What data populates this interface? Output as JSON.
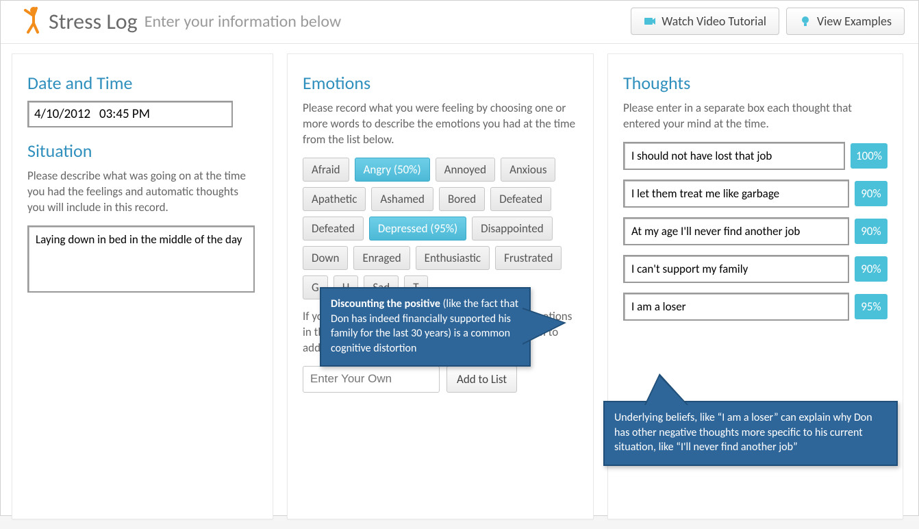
{
  "header": {
    "title": "Stress Log",
    "subtitle": "Enter your information below",
    "watch_button": "Watch Video Tutorial",
    "examples_button": "View Examples"
  },
  "left": {
    "date_heading": "Date and Time",
    "date_value": "4/10/2012",
    "time_value": "03:45 PM",
    "situation_heading": "Situation",
    "situation_desc": "Please describe what was going on at the time you had the feelings and automatic thoughts you will include in this record.",
    "situation_value": "Laying down in bed in the middle of the day"
  },
  "emotions": {
    "heading": "Emotions",
    "desc": "Please record what you were feeling by choosing one or more words to describe the emotions you had at the time from the list below.",
    "chips": [
      {
        "label": "Afraid",
        "selected": false
      },
      {
        "label": "Angry (50%)",
        "selected": true
      },
      {
        "label": "Annoyed",
        "selected": false
      },
      {
        "label": "Anxious",
        "selected": false
      },
      {
        "label": "Apathetic",
        "selected": false
      },
      {
        "label": "Ashamed",
        "selected": false
      },
      {
        "label": "Bored",
        "selected": false
      },
      {
        "label": "Defeated",
        "selected": false
      },
      {
        "label": "Defeated",
        "selected": false
      },
      {
        "label": "Depressed (95%)",
        "selected": true
      },
      {
        "label": "Disappointed",
        "selected": false
      },
      {
        "label": "Down",
        "selected": false
      },
      {
        "label": "Enraged",
        "selected": false
      },
      {
        "label": "Enthusiastic",
        "selected": false
      },
      {
        "label": "Frustrated",
        "selected": false
      },
      {
        "label": "G",
        "selected": false
      },
      {
        "label": "H",
        "selected": false
      },
      {
        "label": "Sad",
        "selected": false
      },
      {
        "label": "T",
        "selected": false
      }
    ],
    "footer_desc": "If you don't see the right word to describe your emotions in the list, enter it on the blank space at the bottom to add it to the list.",
    "own_placeholder": "Enter Your Own",
    "add_button": "Add to List"
  },
  "thoughts": {
    "heading": "Thoughts",
    "desc": "Please enter in a separate box each thought that entered your mind at the time.",
    "items": [
      {
        "text": "I should not have lost that job",
        "pct": "100%"
      },
      {
        "text": "I let them treat me like garbage",
        "pct": "90%"
      },
      {
        "text": "At my age I'll never find another job",
        "pct": "90%"
      },
      {
        "text": "I can't support my family",
        "pct": "90%"
      },
      {
        "text": "I am a loser",
        "pct": "95%"
      }
    ]
  },
  "callouts": {
    "c1_bold": "Discounting the positive",
    "c1_rest": " (like the fact that Don has indeed financially supported his family for the last 30 years) is a common cognitive distortion",
    "c2": "Underlying beliefs, like “I am a loser” can explain why Don has other negative thoughts more specific to his current situation, like “I'll never find another job”"
  }
}
